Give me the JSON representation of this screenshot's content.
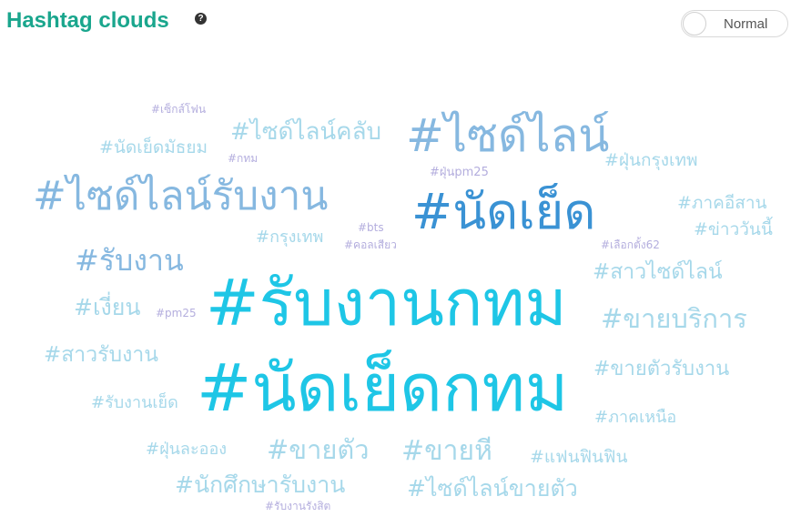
{
  "header": {
    "title": "Hashtag clouds",
    "help_icon": "question-circle-icon",
    "mode_toggle_label": "Normal"
  },
  "cloud": [
    {
      "text": "#รับงานกทม",
      "color": "#1ec6e6"
    },
    {
      "text": "#นัดเย็ดกทม",
      "color": "#1ec6e6"
    },
    {
      "text": "#นัดเย็ด",
      "color": "#3a92d4"
    },
    {
      "text": "#ไซด์ไลน์",
      "color": "#86b8e0"
    },
    {
      "text": "#ไซด์ไลน์รับงาน",
      "color": "#86b8e0"
    },
    {
      "text": "#รับงาน",
      "color": "#86b8e0"
    },
    {
      "text": "#ไซด์ไลน์คลับ",
      "color": "#a6d8ea"
    },
    {
      "text": "#ขายบริการ",
      "color": "#a6d8ea"
    },
    {
      "text": "#ขายหี",
      "color": "#a6d8ea"
    },
    {
      "text": "#ขายตัว",
      "color": "#a6d8ea"
    },
    {
      "text": "#ไซด์ไลน์ขายตัว",
      "color": "#a6d8ea"
    },
    {
      "text": "#นักศึกษารับงาน",
      "color": "#a6d8ea"
    },
    {
      "text": "#สาวไซด์ไลน์",
      "color": "#a6d8ea"
    },
    {
      "text": "#ขายตัวรับงาน",
      "color": "#a6d8ea"
    },
    {
      "text": "#สาวรับงาน",
      "color": "#a6d8ea"
    },
    {
      "text": "#เงี่ยน",
      "color": "#a6d8ea"
    },
    {
      "text": "#นัดเย็ดมัธยม",
      "color": "#a6d8ea"
    },
    {
      "text": "#ฝุ่นกรุงเทพ",
      "color": "#a6d8ea"
    },
    {
      "text": "#ภาคอีสาน",
      "color": "#a6d8ea"
    },
    {
      "text": "#ข่าววันนี้",
      "color": "#a6d8ea"
    },
    {
      "text": "#กรุงเทพ",
      "color": "#a6d8ea"
    },
    {
      "text": "#รับงานเย็ด",
      "color": "#a6d8ea"
    },
    {
      "text": "#ฝุ่นละออง",
      "color": "#a6d8ea"
    },
    {
      "text": "#แฟนฟินฟิน",
      "color": "#a6d8ea"
    },
    {
      "text": "#ภาคเหนือ",
      "color": "#a6d8ea"
    },
    {
      "text": "#เซ็กส์โฟน",
      "color": "#b4aede"
    },
    {
      "text": "#กทม",
      "color": "#b4aede"
    },
    {
      "text": "#ฝุ่นpm25",
      "color": "#b4aede"
    },
    {
      "text": "#bts",
      "color": "#b4aede"
    },
    {
      "text": "#คอลเสียว",
      "color": "#b4aede"
    },
    {
      "text": "#เลือกตั้ง62",
      "color": "#b4aede"
    },
    {
      "text": "#pm25",
      "color": "#b4aede"
    },
    {
      "text": "#รับงานรังสิต",
      "color": "#b4aede"
    }
  ]
}
